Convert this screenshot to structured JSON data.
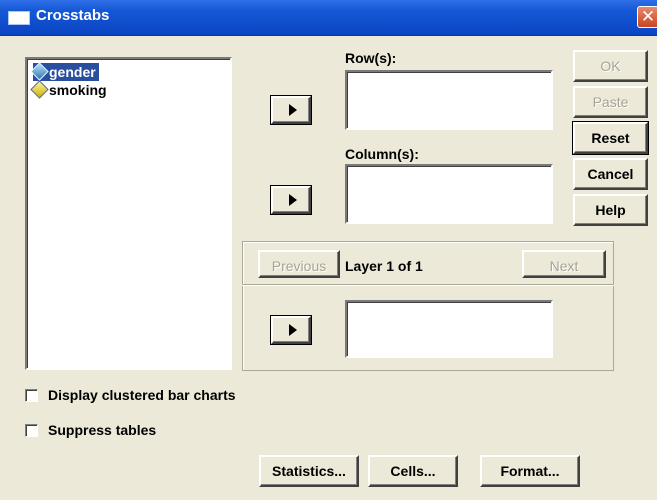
{
  "window": {
    "title": "Crosstabs",
    "close_symbol": "✕"
  },
  "variables": [
    {
      "name": "gender",
      "selected": true,
      "icon": "variable-icon"
    },
    {
      "name": "smoking",
      "selected": false,
      "icon": "variable-icon"
    }
  ],
  "targets": {
    "rows_label": "Row(s):",
    "columns_label": "Column(s):"
  },
  "layer": {
    "previous_label": "Previous",
    "next_label": "Next",
    "status": "Layer 1 of 1"
  },
  "side_buttons": {
    "ok": "OK",
    "paste": "Paste",
    "reset": "Reset",
    "cancel": "Cancel",
    "help": "Help"
  },
  "options": {
    "clustered_bar": "Display clustered bar charts",
    "suppress_tables": "Suppress tables"
  },
  "bottom_buttons": {
    "statistics": "Statistics...",
    "cells": "Cells...",
    "format": "Format..."
  }
}
